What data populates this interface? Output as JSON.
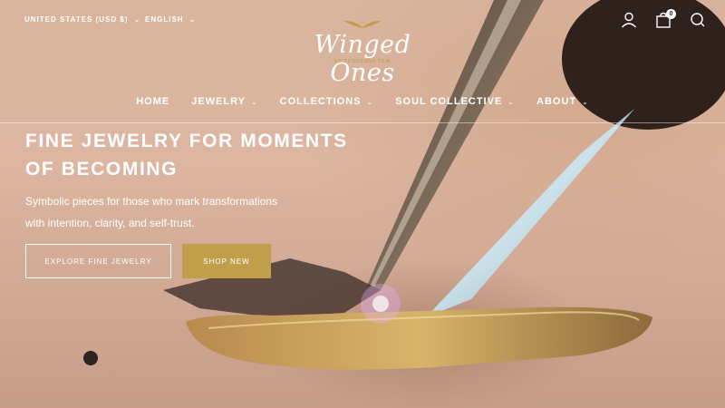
{
  "topbar": {
    "currency": "UNITED STATES (USD $)",
    "language": "ENGLISH"
  },
  "logo": {
    "title": "Winged Ones",
    "subtitle": "BY TEQUESNA TEW",
    "accent_color": "#c19f4a"
  },
  "header_icons": {
    "account": "user-icon",
    "cart": "cart-icon",
    "cart_count": "0",
    "search": "search-icon"
  },
  "nav": {
    "items": [
      {
        "label": "HOME",
        "has_dropdown": false
      },
      {
        "label": "JEWELRY",
        "has_dropdown": true
      },
      {
        "label": "COLLECTIONS",
        "has_dropdown": true
      },
      {
        "label": "SOUL COLLECTIVE",
        "has_dropdown": true
      },
      {
        "label": "ABOUT",
        "has_dropdown": true
      }
    ]
  },
  "hero": {
    "headline_line1": "FINE JEWELRY FOR MOMENTS",
    "headline_line2": "OF BECOMING",
    "subtext_line1": "Symbolic pieces for those who mark transformations",
    "subtext_line2": "with intention, clarity, and self-trust.",
    "primary_button": "EXPLORE FINE JEWELRY",
    "secondary_button": "SHOP NEW",
    "button_color": "#c19f4a"
  }
}
